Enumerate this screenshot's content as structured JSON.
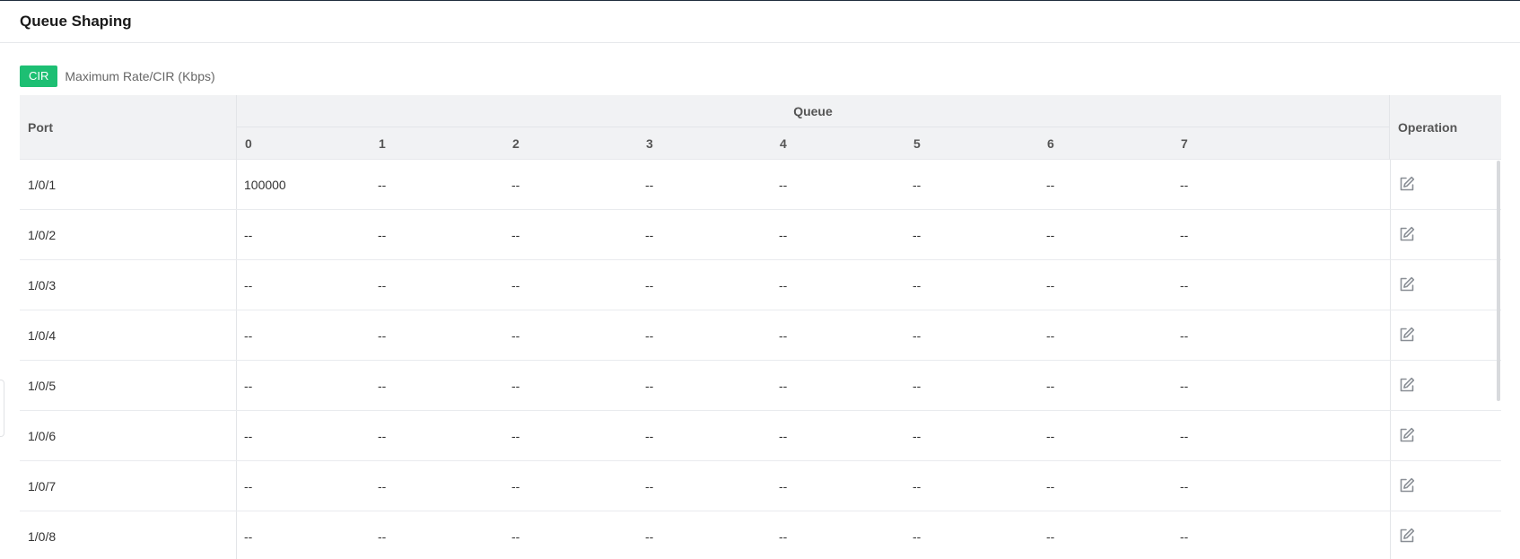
{
  "header": {
    "title": "Queue Shaping"
  },
  "legend": {
    "badge": "CIR",
    "text": "Maximum Rate/CIR (Kbps)"
  },
  "table": {
    "port_header": "Port",
    "queue_header": "Queue",
    "operation_header": "Operation",
    "queue_columns": [
      "0",
      "1",
      "2",
      "3",
      "4",
      "5",
      "6",
      "7"
    ],
    "rows": [
      {
        "port": "1/0/1",
        "queues": [
          "100000",
          "--",
          "--",
          "--",
          "--",
          "--",
          "--",
          "--"
        ]
      },
      {
        "port": "1/0/2",
        "queues": [
          "--",
          "--",
          "--",
          "--",
          "--",
          "--",
          "--",
          "--"
        ]
      },
      {
        "port": "1/0/3",
        "queues": [
          "--",
          "--",
          "--",
          "--",
          "--",
          "--",
          "--",
          "--"
        ]
      },
      {
        "port": "1/0/4",
        "queues": [
          "--",
          "--",
          "--",
          "--",
          "--",
          "--",
          "--",
          "--"
        ]
      },
      {
        "port": "1/0/5",
        "queues": [
          "--",
          "--",
          "--",
          "--",
          "--",
          "--",
          "--",
          "--"
        ]
      },
      {
        "port": "1/0/6",
        "queues": [
          "--",
          "--",
          "--",
          "--",
          "--",
          "--",
          "--",
          "--"
        ]
      },
      {
        "port": "1/0/7",
        "queues": [
          "--",
          "--",
          "--",
          "--",
          "--",
          "--",
          "--",
          "--"
        ]
      },
      {
        "port": "1/0/8",
        "queues": [
          "--",
          "--",
          "--",
          "--",
          "--",
          "--",
          "--",
          "--"
        ]
      }
    ],
    "edit_icon": "edit-icon"
  },
  "colors": {
    "badge": "#1dbf73",
    "header_bg": "#f1f2f4",
    "icon": "#8a8f96"
  }
}
